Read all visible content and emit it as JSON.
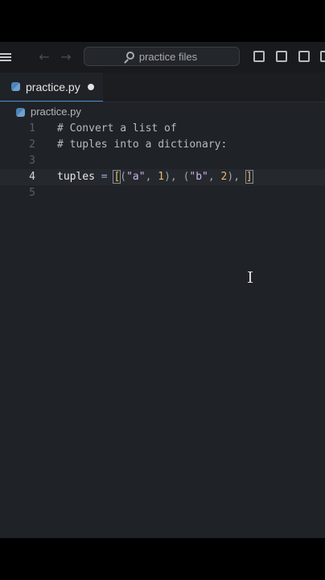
{
  "search": {
    "label": "practice files"
  },
  "tabs": [
    {
      "label": "practice.py",
      "modified": true
    }
  ],
  "breadcrumb": {
    "file": "practice.py"
  },
  "editor": {
    "current_line": 4,
    "lines": [
      {
        "number": "1",
        "text": "# Convert a list of"
      },
      {
        "number": "2",
        "text": "# tuples into a dictionary:"
      },
      {
        "number": "3",
        "text": ""
      },
      {
        "number": "4",
        "text": "tuples = [(\"a\", 1), (\"b\", 2), ]"
      },
      {
        "number": "5",
        "text": ""
      }
    ]
  },
  "icons": {
    "menu": "menu-icon",
    "back": "arrow-left-icon",
    "forward": "arrow-right-icon",
    "search": "search-icon",
    "layout1": "toggle-primary-sidebar-icon",
    "layout2": "toggle-panel-icon",
    "layout3": "toggle-secondary-sidebar-icon",
    "file": "python-file-icon"
  },
  "colors": {
    "background": "#1f2226",
    "accent": "#4a88c7"
  }
}
